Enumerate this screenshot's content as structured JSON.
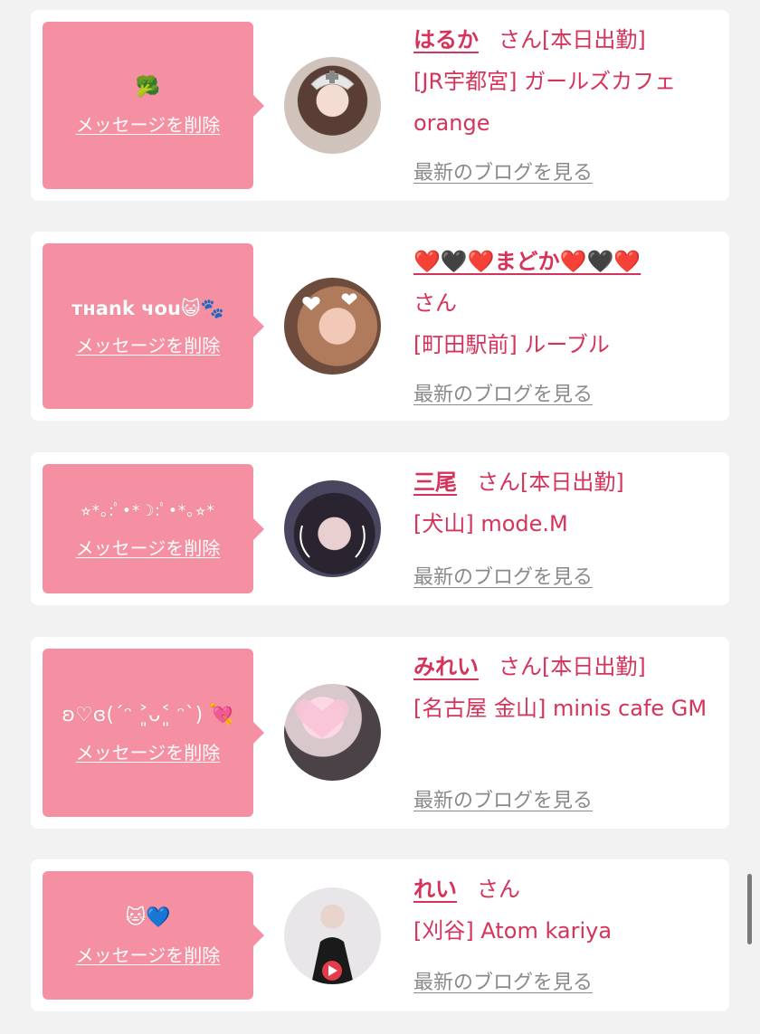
{
  "delete_label": "メッセージを削除",
  "blog_label": "最新のブログを見る",
  "san_suffix": "さん",
  "cards": [
    {
      "message": "🥦",
      "name": "はるか",
      "status": "[本日出勤]",
      "shop": "[JR宇都宮] ガールズカフェ orange",
      "avatar_bg": "#c9b8ad",
      "avatar_icon": "nurse-cap-icon"
    },
    {
      "message": "тнank чou😺🐾",
      "name": "❤️🖤❤️まどか❤️🖤❤️",
      "status": "",
      "shop": "[町田駅前] ルーブル",
      "avatar_bg": "#d9a88f",
      "avatar_icon": "heart-icon"
    },
    {
      "message": "⭐︎*｡:ﾟ•*☽:ﾟ•*｡⭐︎*",
      "name": "三尾",
      "status": "[本日出勤]",
      "shop": "[犬山] mode.M",
      "avatar_bg": "#3d3845",
      "avatar_icon": "wink-icon"
    },
    {
      "message": "ʚ♡ɞ(ˊᵔ ˃͈ᴗ˂͈ ᵔˋ) 💘",
      "name": "みれい",
      "status": "[本日出勤]",
      "shop": "[名古屋 金山] minis cafe GM",
      "avatar_bg": "#9a8f94",
      "avatar_icon": "heart-sticker-icon"
    },
    {
      "message": "🐱💙",
      "name": "れい",
      "status": "",
      "shop": "[刈谷] Atom kariya",
      "avatar_bg": "#e8e6e8",
      "avatar_icon": "play-icon"
    }
  ]
}
